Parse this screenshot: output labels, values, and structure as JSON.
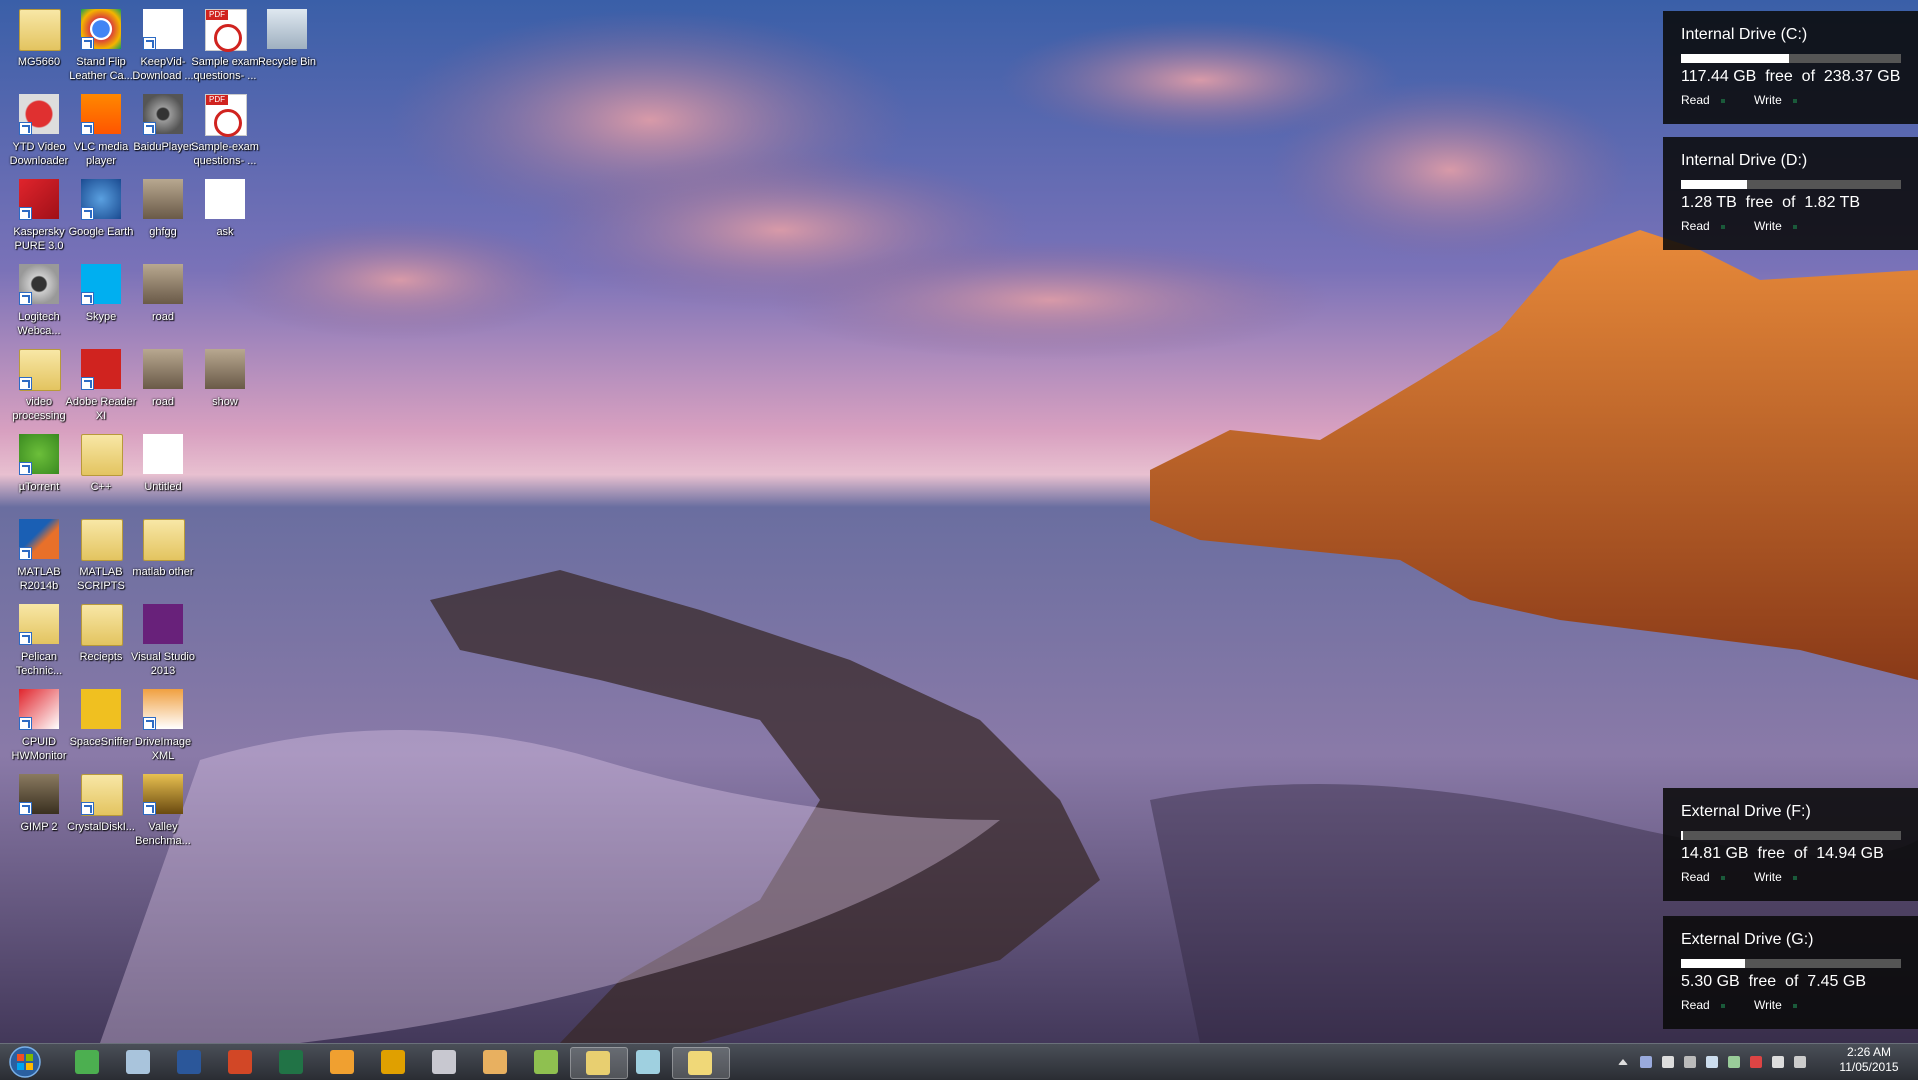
{
  "desktop_icons": [
    {
      "label": "MG5660",
      "kind": "folder",
      "shortcut": false
    },
    {
      "label": "Stand Flip Leather Ca...",
      "kind": "chrome-icon",
      "shortcut": true
    },
    {
      "label": "KeepVid-Download ...",
      "kind": "document-icon",
      "shortcut": true
    },
    {
      "label": "Sample exam questions- ...",
      "kind": "pdf-icon",
      "shortcut": false
    },
    {
      "label": "Recycle Bin",
      "kind": "recycle-bin-icon",
      "shortcut": false
    },
    {
      "label": "YTD Video Downloader",
      "kind": "ytd-icon",
      "shortcut": true
    },
    {
      "label": "VLC media player",
      "kind": "vlc-icon",
      "shortcut": true
    },
    {
      "label": "BaiduPlayer",
      "kind": "film-reel-icon",
      "shortcut": true
    },
    {
      "label": "Sample-exam questions- ...",
      "kind": "pdf-icon",
      "shortcut": false
    },
    {
      "label": "Kaspersky PURE 3.0",
      "kind": "kaspersky-icon",
      "shortcut": true
    },
    {
      "label": "Google Earth",
      "kind": "globe-icon",
      "shortcut": true
    },
    {
      "label": "ghfgg",
      "kind": "image-icon",
      "shortcut": false
    },
    {
      "label": "ask",
      "kind": "text-file-icon",
      "shortcut": false
    },
    {
      "label": "Logitech Webca...",
      "kind": "webcam-icon",
      "shortcut": true
    },
    {
      "label": "Skype",
      "kind": "skype-icon",
      "shortcut": true
    },
    {
      "label": "road",
      "kind": "image-icon",
      "shortcut": false
    },
    {
      "label": "video processing",
      "kind": "folder",
      "shortcut": true
    },
    {
      "label": "Adobe Reader XI",
      "kind": "adobe-reader-icon",
      "shortcut": true
    },
    {
      "label": "road",
      "kind": "image-icon",
      "shortcut": false
    },
    {
      "label": "show",
      "kind": "image-icon",
      "shortcut": false
    },
    {
      "label": "µTorrent",
      "kind": "utorrent-icon",
      "shortcut": true
    },
    {
      "label": "C++",
      "kind": "folder",
      "shortcut": false
    },
    {
      "label": "Untitled",
      "kind": "document-icon",
      "shortcut": false
    },
    {
      "label": "MATLAB R2014b",
      "kind": "matlab-icon",
      "shortcut": true
    },
    {
      "label": "MATLAB SCRIPTS",
      "kind": "folder",
      "shortcut": false
    },
    {
      "label": "matlab other",
      "kind": "folder",
      "shortcut": false
    },
    {
      "label": "Pelican Technic...",
      "kind": "chrome-folder-icon",
      "shortcut": true
    },
    {
      "label": "Reciepts",
      "kind": "folder",
      "shortcut": false
    },
    {
      "label": "Visual Studio 2013",
      "kind": "visual-studio-icon",
      "shortcut": false
    },
    {
      "label": "CPUID HWMonitor",
      "kind": "hwmonitor-icon",
      "shortcut": true
    },
    {
      "label": "SpaceSniffer",
      "kind": "puzzle-icon",
      "shortcut": false
    },
    {
      "label": "DriveImage XML",
      "kind": "driveimage-icon",
      "shortcut": true
    },
    {
      "label": "GIMP 2",
      "kind": "gimp-icon",
      "shortcut": true
    },
    {
      "label": "CrystalDiskI...",
      "kind": "folder",
      "shortcut": true
    },
    {
      "label": "Valley Benchma...",
      "kind": "valley-icon",
      "shortcut": true
    }
  ],
  "drive_gadgets": [
    {
      "title": "Internal Drive (C:)",
      "free": "117.44 GB",
      "total": "238.37 GB",
      "free_fraction": 0.49,
      "read": "Read",
      "write": "Write",
      "size_text": "117.44 GB  free  of  238.37 GB"
    },
    {
      "title": "Internal Drive (D:)",
      "free": "1.28 TB",
      "total": "1.82 TB",
      "free_fraction": 0.3,
      "read": "Read",
      "write": "Write",
      "size_text": "1.28 TB  free  of  1.82 TB"
    },
    {
      "title": "External Drive (F:)",
      "free": "14.81 GB",
      "total": "14.94 GB",
      "free_fraction": 0.01,
      "read": "Read",
      "write": "Write",
      "size_text": "14.81 GB  free  of  14.94 GB"
    },
    {
      "title": "External Drive (G:)",
      "free": "5.30 GB",
      "total": "7.45 GB",
      "free_fraction": 0.29,
      "read": "Read",
      "write": "Write",
      "size_text": "5.30 GB  free  of  7.45 GB"
    }
  ],
  "taskbar": {
    "start": "windows-start-orb",
    "items": [
      {
        "name": "chrome-taskbar-icon",
        "color": "#4caf50",
        "active": false
      },
      {
        "name": "calculator-taskbar-icon",
        "color": "#a9c4dc",
        "active": false
      },
      {
        "name": "word-taskbar-icon",
        "color": "#2b579a",
        "active": false
      },
      {
        "name": "powerpoint-taskbar-icon",
        "color": "#d24726",
        "active": false
      },
      {
        "name": "excel-taskbar-icon",
        "color": "#217346",
        "active": false
      },
      {
        "name": "media-player-taskbar-icon",
        "color": "#f0a030",
        "active": false
      },
      {
        "name": "headphones-taskbar-icon",
        "color": "#e0a000",
        "active": false
      },
      {
        "name": "snipping-tool-taskbar-icon",
        "color": "#c8c8d0",
        "active": false
      },
      {
        "name": "paint-taskbar-icon",
        "color": "#e8b060",
        "active": false
      },
      {
        "name": "notepad-plus-taskbar-icon",
        "color": "#8fc050",
        "active": false
      },
      {
        "name": "explorer-taskbar-icon",
        "color": "#e8cf70",
        "active": true
      },
      {
        "name": "notes-taskbar-icon",
        "color": "#9fd0e0",
        "active": false
      },
      {
        "name": "folder-taskbar-icon",
        "color": "#f0d878",
        "active": true
      }
    ],
    "tray_icons": [
      "show-hidden-icons-icon",
      "droplet-icon",
      "action-center-flag-icon",
      "network-device-icon",
      "safely-remove-icon",
      "battery-icon",
      "security-icon",
      "volume-icon",
      "network-icon"
    ],
    "time": "2:26 AM",
    "date": "11/05/2015"
  }
}
